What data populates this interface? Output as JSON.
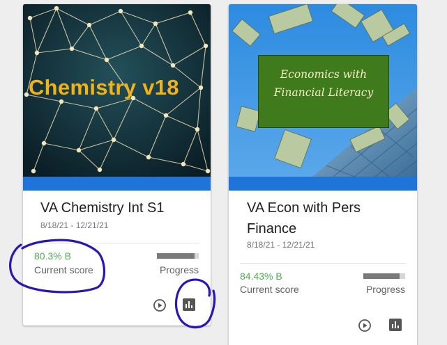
{
  "colors": {
    "accent_blue": "#1e74d8",
    "score_green": "#4caf50",
    "annotation_purple": "#2a16b8"
  },
  "courses": [
    {
      "banner_text": "Chemistry v18",
      "title": "VA Chemistry Int S1",
      "dates": "8/18/21 - 12/21/21",
      "score_value": "80.3% B",
      "score_label": "Current score",
      "progress_label": "Progress",
      "progress_fraction": 0.9,
      "icons": [
        "play-circle-icon",
        "bar-chart-icon"
      ]
    },
    {
      "banner_text_line1": "Economics with",
      "banner_text_line2": "Financial Literacy",
      "title_line1": "VA Econ with Pers",
      "title_line2": "Finance",
      "dates": "8/18/21 - 12/21/21",
      "score_value": "84.43% B",
      "score_label": "Current score",
      "progress_label": "Progress",
      "progress_fraction": 0.86,
      "icons": [
        "play-circle-icon",
        "bar-chart-icon"
      ]
    }
  ]
}
